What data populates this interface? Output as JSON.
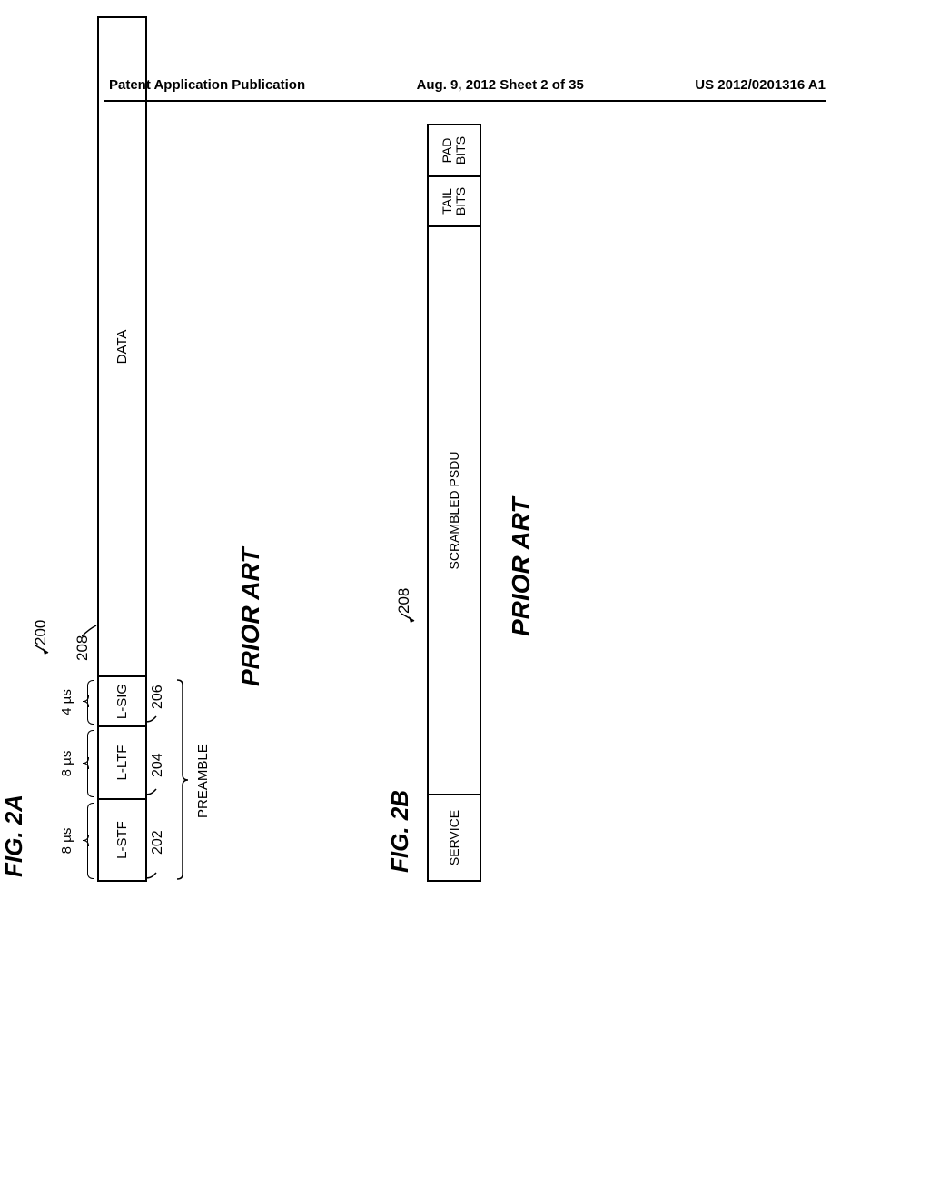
{
  "header": {
    "left": "Patent Application Publication",
    "center": "Aug. 9, 2012  Sheet 2 of 35",
    "right": "US 2012/0201316 A1"
  },
  "fig2a": {
    "title": "FIG. 2A",
    "ref200": "200",
    "timing": {
      "t1": "8 µs",
      "t2": "8 µs",
      "t3": "4 µs"
    },
    "fields": {
      "lstf": "L-STF",
      "lltf": "L-LTF",
      "lsig": "L-SIG",
      "data": "DATA"
    },
    "refs": {
      "r202": "202",
      "r204": "204",
      "r206": "206",
      "r208": "208"
    },
    "preamble": "PREAMBLE",
    "priorArt": "PRIOR ART"
  },
  "fig2b": {
    "title": "FIG. 2B",
    "ref208": "208",
    "fields": {
      "service": "SERVICE",
      "psdu": "SCRAMBLED PSDU",
      "tail": "TAIL BITS",
      "pad": "PAD BITS"
    },
    "priorArt": "PRIOR ART"
  }
}
